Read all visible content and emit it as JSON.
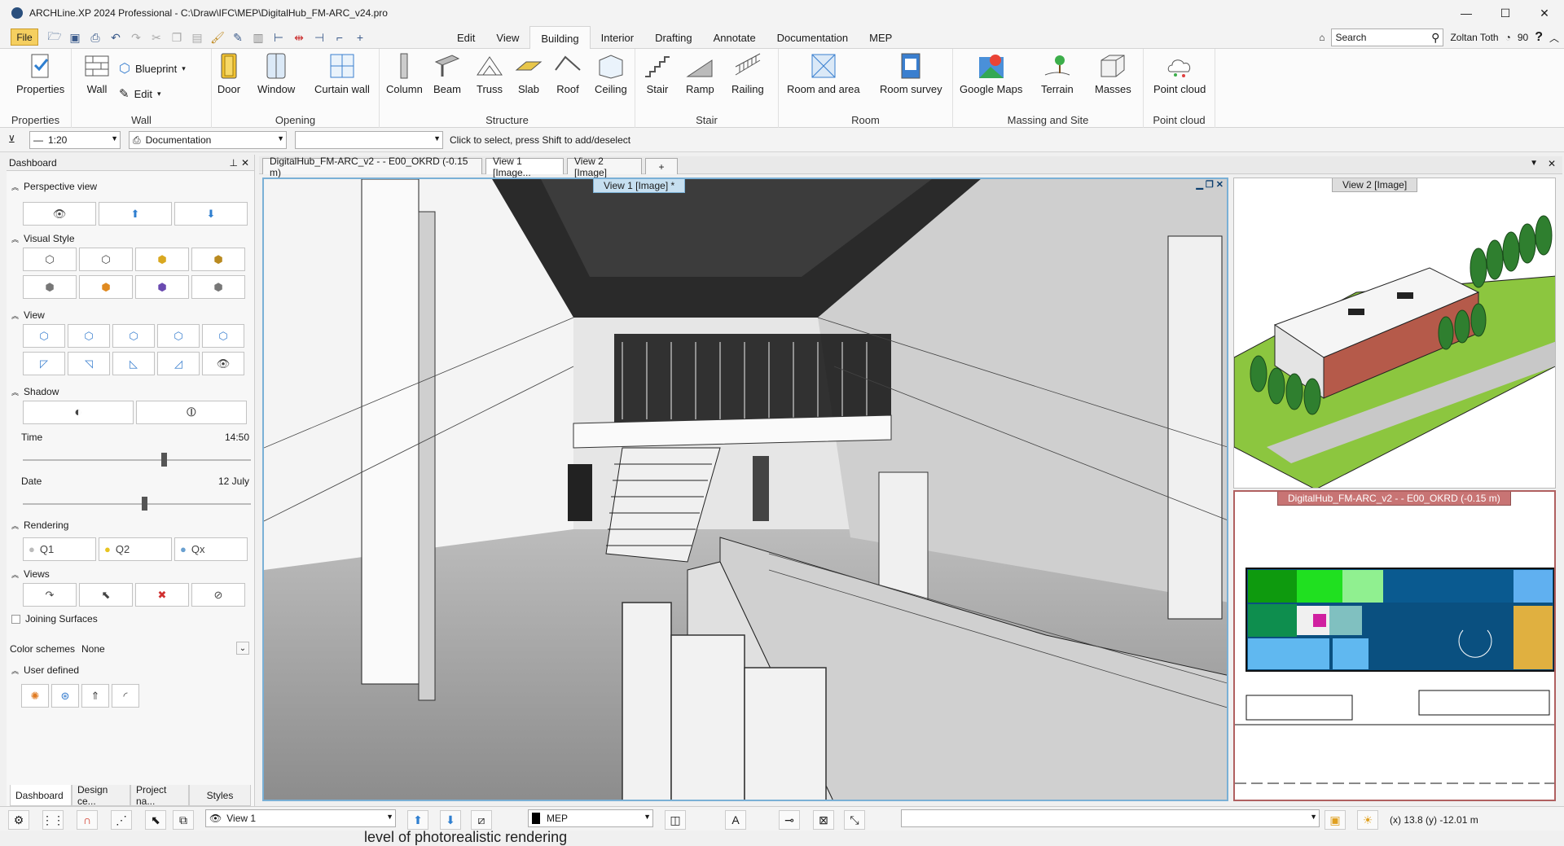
{
  "window": {
    "title": "ARCHLine.XP 2024 Professional - C:\\Draw\\IFC\\MEP\\DigitalHub_FM-ARC_v24.pro",
    "minimize": "—",
    "maximize": "☐",
    "close": "✕"
  },
  "menu": {
    "file": "File",
    "tabs": [
      "Edit",
      "View",
      "Building",
      "Interior",
      "Drafting",
      "Annotate",
      "Documentation",
      "MEP"
    ],
    "active_tab": "Building"
  },
  "user": {
    "search_placeholder": "Search",
    "name": "Zoltan Toth",
    "count": "90"
  },
  "ribbon": {
    "properties": {
      "label": "Properties",
      "group": "Properties"
    },
    "wall_group": {
      "wall": "Wall",
      "blueprint": "Blueprint",
      "edit": "Edit",
      "group": "Wall"
    },
    "opening": {
      "door": "Door",
      "window": "Window",
      "curtain": "Curtain wall",
      "group": "Opening"
    },
    "structure": {
      "column": "Column",
      "beam": "Beam",
      "truss": "Truss",
      "slab": "Slab",
      "roof": "Roof",
      "ceiling": "Ceiling",
      "group": "Structure"
    },
    "stair_group": {
      "stair": "Stair",
      "ramp": "Ramp",
      "railing": "Railing",
      "group": "Stair"
    },
    "room_group": {
      "room": "Room and area",
      "survey": "Room survey",
      "group": "Room"
    },
    "massing": {
      "maps": "Google Maps",
      "terrain": "Terrain",
      "masses": "Masses",
      "group": "Massing and Site"
    },
    "cloud": {
      "point": "Point cloud",
      "group": "Point cloud"
    }
  },
  "toolbar2": {
    "scale": "1:20",
    "doc": "Documentation",
    "hint": "Click to select, press Shift to add/deselect"
  },
  "dashboard": {
    "title": "Dashboard",
    "sections": {
      "perspective": "Perspective view",
      "visual": "Visual Style",
      "view": "View",
      "shadow": "Shadow",
      "rendering": "Rendering",
      "views": "Views",
      "user": "User defined"
    },
    "time_label": "Time",
    "time_value": "14:50",
    "date_label": "Date",
    "date_value": "12 July",
    "render_q": [
      "Q1",
      "Q2",
      "Qx"
    ],
    "joining": "Joining Surfaces",
    "color_schemes_label": "Color schemes",
    "color_schemes_value": "None",
    "bottom_tabs": [
      "Dashboard",
      "Design ce...",
      "Project na...",
      "Styles"
    ]
  },
  "view_tabs": [
    "DigitalHub_FM-ARC_v2 -  - E00_OKRD (-0.15 m)",
    "View 1 [Image...",
    "View 2 [Image]",
    "+"
  ],
  "views": {
    "main": "View 1 [Image] *",
    "top_right": "View 2 [Image]",
    "bottom_right": "DigitalHub_FM-ARC_v2 -  - E00_OKRD (-0.15 m)"
  },
  "statusbar": {
    "view": "View 1",
    "layer": "MEP",
    "coords": "(x) 13.8   (y) -12.01 m"
  },
  "overlay_text": "level of photorealistic rendering"
}
